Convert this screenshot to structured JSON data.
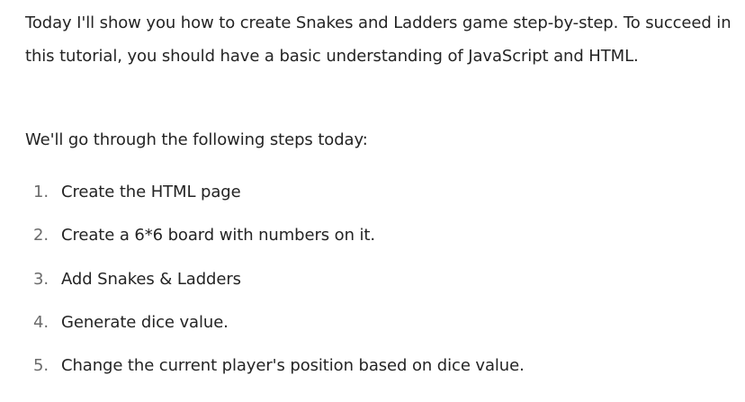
{
  "article": {
    "intro": "Today I'll show you how to create Snakes and Ladders game step-by-step. To succeed in this tutorial, you should have a basic understanding of JavaScript and HTML.",
    "lead": "We'll go through the following steps today:",
    "steps": [
      {
        "number": "1.",
        "text": "Create the HTML page"
      },
      {
        "number": "2.",
        "text": "Create a 6*6 board with numbers on it."
      },
      {
        "number": "3.",
        "text": "Add Snakes & Ladders"
      },
      {
        "number": "4.",
        "text": "Generate dice value."
      },
      {
        "number": "5.",
        "text": "Change the current player's position based on dice value."
      }
    ]
  }
}
